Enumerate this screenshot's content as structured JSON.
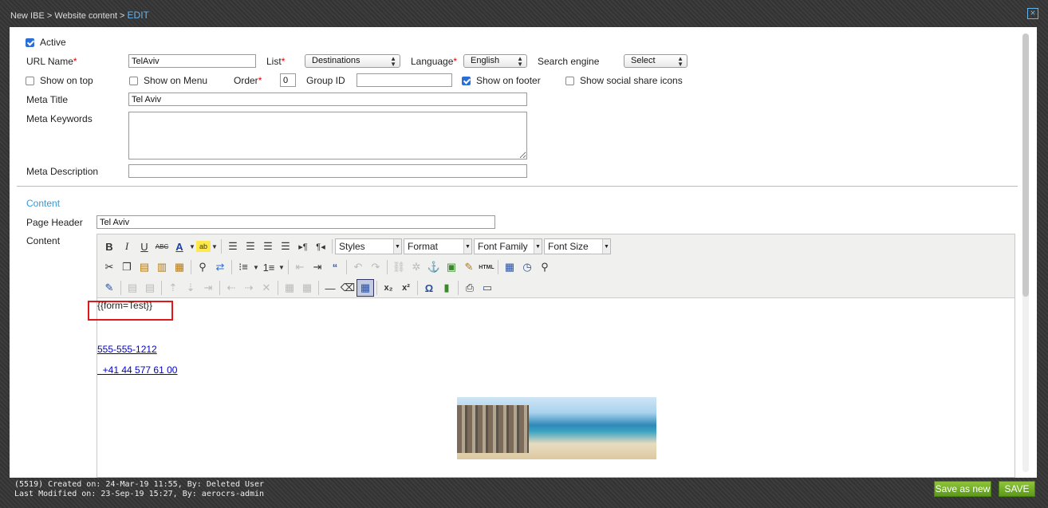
{
  "breadcrumb": {
    "path": "New IBE > Website content > ",
    "current": "EDIT"
  },
  "close_glyph": "×",
  "form": {
    "active_label": "Active",
    "active_checked": true,
    "url_name_label": "URL Name",
    "url_name_value": "TelAviv",
    "list_label": "List",
    "list_value": "Destinations",
    "language_label": "Language",
    "language_value": "English",
    "search_engine_label": "Search engine",
    "search_engine_value": "Select",
    "show_on_top_label": "Show on top",
    "show_on_menu_label": "Show on Menu",
    "order_label": "Order",
    "order_value": "0",
    "group_id_label": "Group ID",
    "group_id_value": "",
    "show_on_footer_label": "Show on footer",
    "show_on_footer_checked": true,
    "show_social_label": "Show social share icons",
    "meta_title_label": "Meta Title",
    "meta_title_value": "Tel Aviv",
    "meta_keywords_label": "Meta Keywords",
    "meta_keywords_value": "",
    "meta_description_label": "Meta Description",
    "meta_description_value": "",
    "required_mark": "*"
  },
  "content": {
    "section_title": "Content",
    "page_header_label": "Page Header",
    "page_header_value": "Tel Aviv",
    "content_label": "Content"
  },
  "editor": {
    "dropdowns": {
      "styles": "Styles",
      "format": "Format",
      "font_family": "Font Family",
      "font_size": "Font Size"
    },
    "body": {
      "form_tag": "{{form=Test}}",
      "phone1": "555-555-1212",
      "phone2": "  +41 44 577 61 00"
    }
  },
  "footer": {
    "created": "(5519) Created on: 24-Mar-19 11:55, By: Deleted User",
    "modified": "Last Modified on: 23-Sep-19 15:27, By: aerocrs-admin",
    "save_as_new": "Save as new",
    "save": "SAVE"
  },
  "colors": {
    "accent": "#3a97d4",
    "required": "#dd0000",
    "save_green": "#6aa823",
    "highlight": "#e01818"
  }
}
